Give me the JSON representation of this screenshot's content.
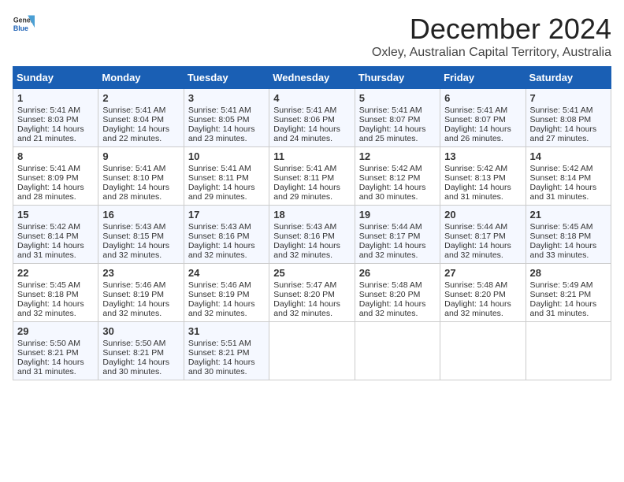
{
  "logo": {
    "general": "General",
    "blue": "Blue"
  },
  "title": "December 2024",
  "subtitle": "Oxley, Australian Capital Territory, Australia",
  "days_of_week": [
    "Sunday",
    "Monday",
    "Tuesday",
    "Wednesday",
    "Thursday",
    "Friday",
    "Saturday"
  ],
  "weeks": [
    [
      {
        "day": 1,
        "sunrise": "5:41 AM",
        "sunset": "8:03 PM",
        "daylight": "14 hours and 21 minutes."
      },
      {
        "day": 2,
        "sunrise": "5:41 AM",
        "sunset": "8:04 PM",
        "daylight": "14 hours and 22 minutes."
      },
      {
        "day": 3,
        "sunrise": "5:41 AM",
        "sunset": "8:05 PM",
        "daylight": "14 hours and 23 minutes."
      },
      {
        "day": 4,
        "sunrise": "5:41 AM",
        "sunset": "8:06 PM",
        "daylight": "14 hours and 24 minutes."
      },
      {
        "day": 5,
        "sunrise": "5:41 AM",
        "sunset": "8:07 PM",
        "daylight": "14 hours and 25 minutes."
      },
      {
        "day": 6,
        "sunrise": "5:41 AM",
        "sunset": "8:07 PM",
        "daylight": "14 hours and 26 minutes."
      },
      {
        "day": 7,
        "sunrise": "5:41 AM",
        "sunset": "8:08 PM",
        "daylight": "14 hours and 27 minutes."
      }
    ],
    [
      {
        "day": 8,
        "sunrise": "5:41 AM",
        "sunset": "8:09 PM",
        "daylight": "14 hours and 28 minutes."
      },
      {
        "day": 9,
        "sunrise": "5:41 AM",
        "sunset": "8:10 PM",
        "daylight": "14 hours and 28 minutes."
      },
      {
        "day": 10,
        "sunrise": "5:41 AM",
        "sunset": "8:11 PM",
        "daylight": "14 hours and 29 minutes."
      },
      {
        "day": 11,
        "sunrise": "5:41 AM",
        "sunset": "8:11 PM",
        "daylight": "14 hours and 29 minutes."
      },
      {
        "day": 12,
        "sunrise": "5:42 AM",
        "sunset": "8:12 PM",
        "daylight": "14 hours and 30 minutes."
      },
      {
        "day": 13,
        "sunrise": "5:42 AM",
        "sunset": "8:13 PM",
        "daylight": "14 hours and 31 minutes."
      },
      {
        "day": 14,
        "sunrise": "5:42 AM",
        "sunset": "8:14 PM",
        "daylight": "14 hours and 31 minutes."
      }
    ],
    [
      {
        "day": 15,
        "sunrise": "5:42 AM",
        "sunset": "8:14 PM",
        "daylight": "14 hours and 31 minutes."
      },
      {
        "day": 16,
        "sunrise": "5:43 AM",
        "sunset": "8:15 PM",
        "daylight": "14 hours and 32 minutes."
      },
      {
        "day": 17,
        "sunrise": "5:43 AM",
        "sunset": "8:16 PM",
        "daylight": "14 hours and 32 minutes."
      },
      {
        "day": 18,
        "sunrise": "5:43 AM",
        "sunset": "8:16 PM",
        "daylight": "14 hours and 32 minutes."
      },
      {
        "day": 19,
        "sunrise": "5:44 AM",
        "sunset": "8:17 PM",
        "daylight": "14 hours and 32 minutes."
      },
      {
        "day": 20,
        "sunrise": "5:44 AM",
        "sunset": "8:17 PM",
        "daylight": "14 hours and 32 minutes."
      },
      {
        "day": 21,
        "sunrise": "5:45 AM",
        "sunset": "8:18 PM",
        "daylight": "14 hours and 33 minutes."
      }
    ],
    [
      {
        "day": 22,
        "sunrise": "5:45 AM",
        "sunset": "8:18 PM",
        "daylight": "14 hours and 32 minutes."
      },
      {
        "day": 23,
        "sunrise": "5:46 AM",
        "sunset": "8:19 PM",
        "daylight": "14 hours and 32 minutes."
      },
      {
        "day": 24,
        "sunrise": "5:46 AM",
        "sunset": "8:19 PM",
        "daylight": "14 hours and 32 minutes."
      },
      {
        "day": 25,
        "sunrise": "5:47 AM",
        "sunset": "8:20 PM",
        "daylight": "14 hours and 32 minutes."
      },
      {
        "day": 26,
        "sunrise": "5:48 AM",
        "sunset": "8:20 PM",
        "daylight": "14 hours and 32 minutes."
      },
      {
        "day": 27,
        "sunrise": "5:48 AM",
        "sunset": "8:20 PM",
        "daylight": "14 hours and 32 minutes."
      },
      {
        "day": 28,
        "sunrise": "5:49 AM",
        "sunset": "8:21 PM",
        "daylight": "14 hours and 31 minutes."
      }
    ],
    [
      {
        "day": 29,
        "sunrise": "5:50 AM",
        "sunset": "8:21 PM",
        "daylight": "14 hours and 31 minutes."
      },
      {
        "day": 30,
        "sunrise": "5:50 AM",
        "sunset": "8:21 PM",
        "daylight": "14 hours and 30 minutes."
      },
      {
        "day": 31,
        "sunrise": "5:51 AM",
        "sunset": "8:21 PM",
        "daylight": "14 hours and 30 minutes."
      },
      null,
      null,
      null,
      null
    ]
  ]
}
